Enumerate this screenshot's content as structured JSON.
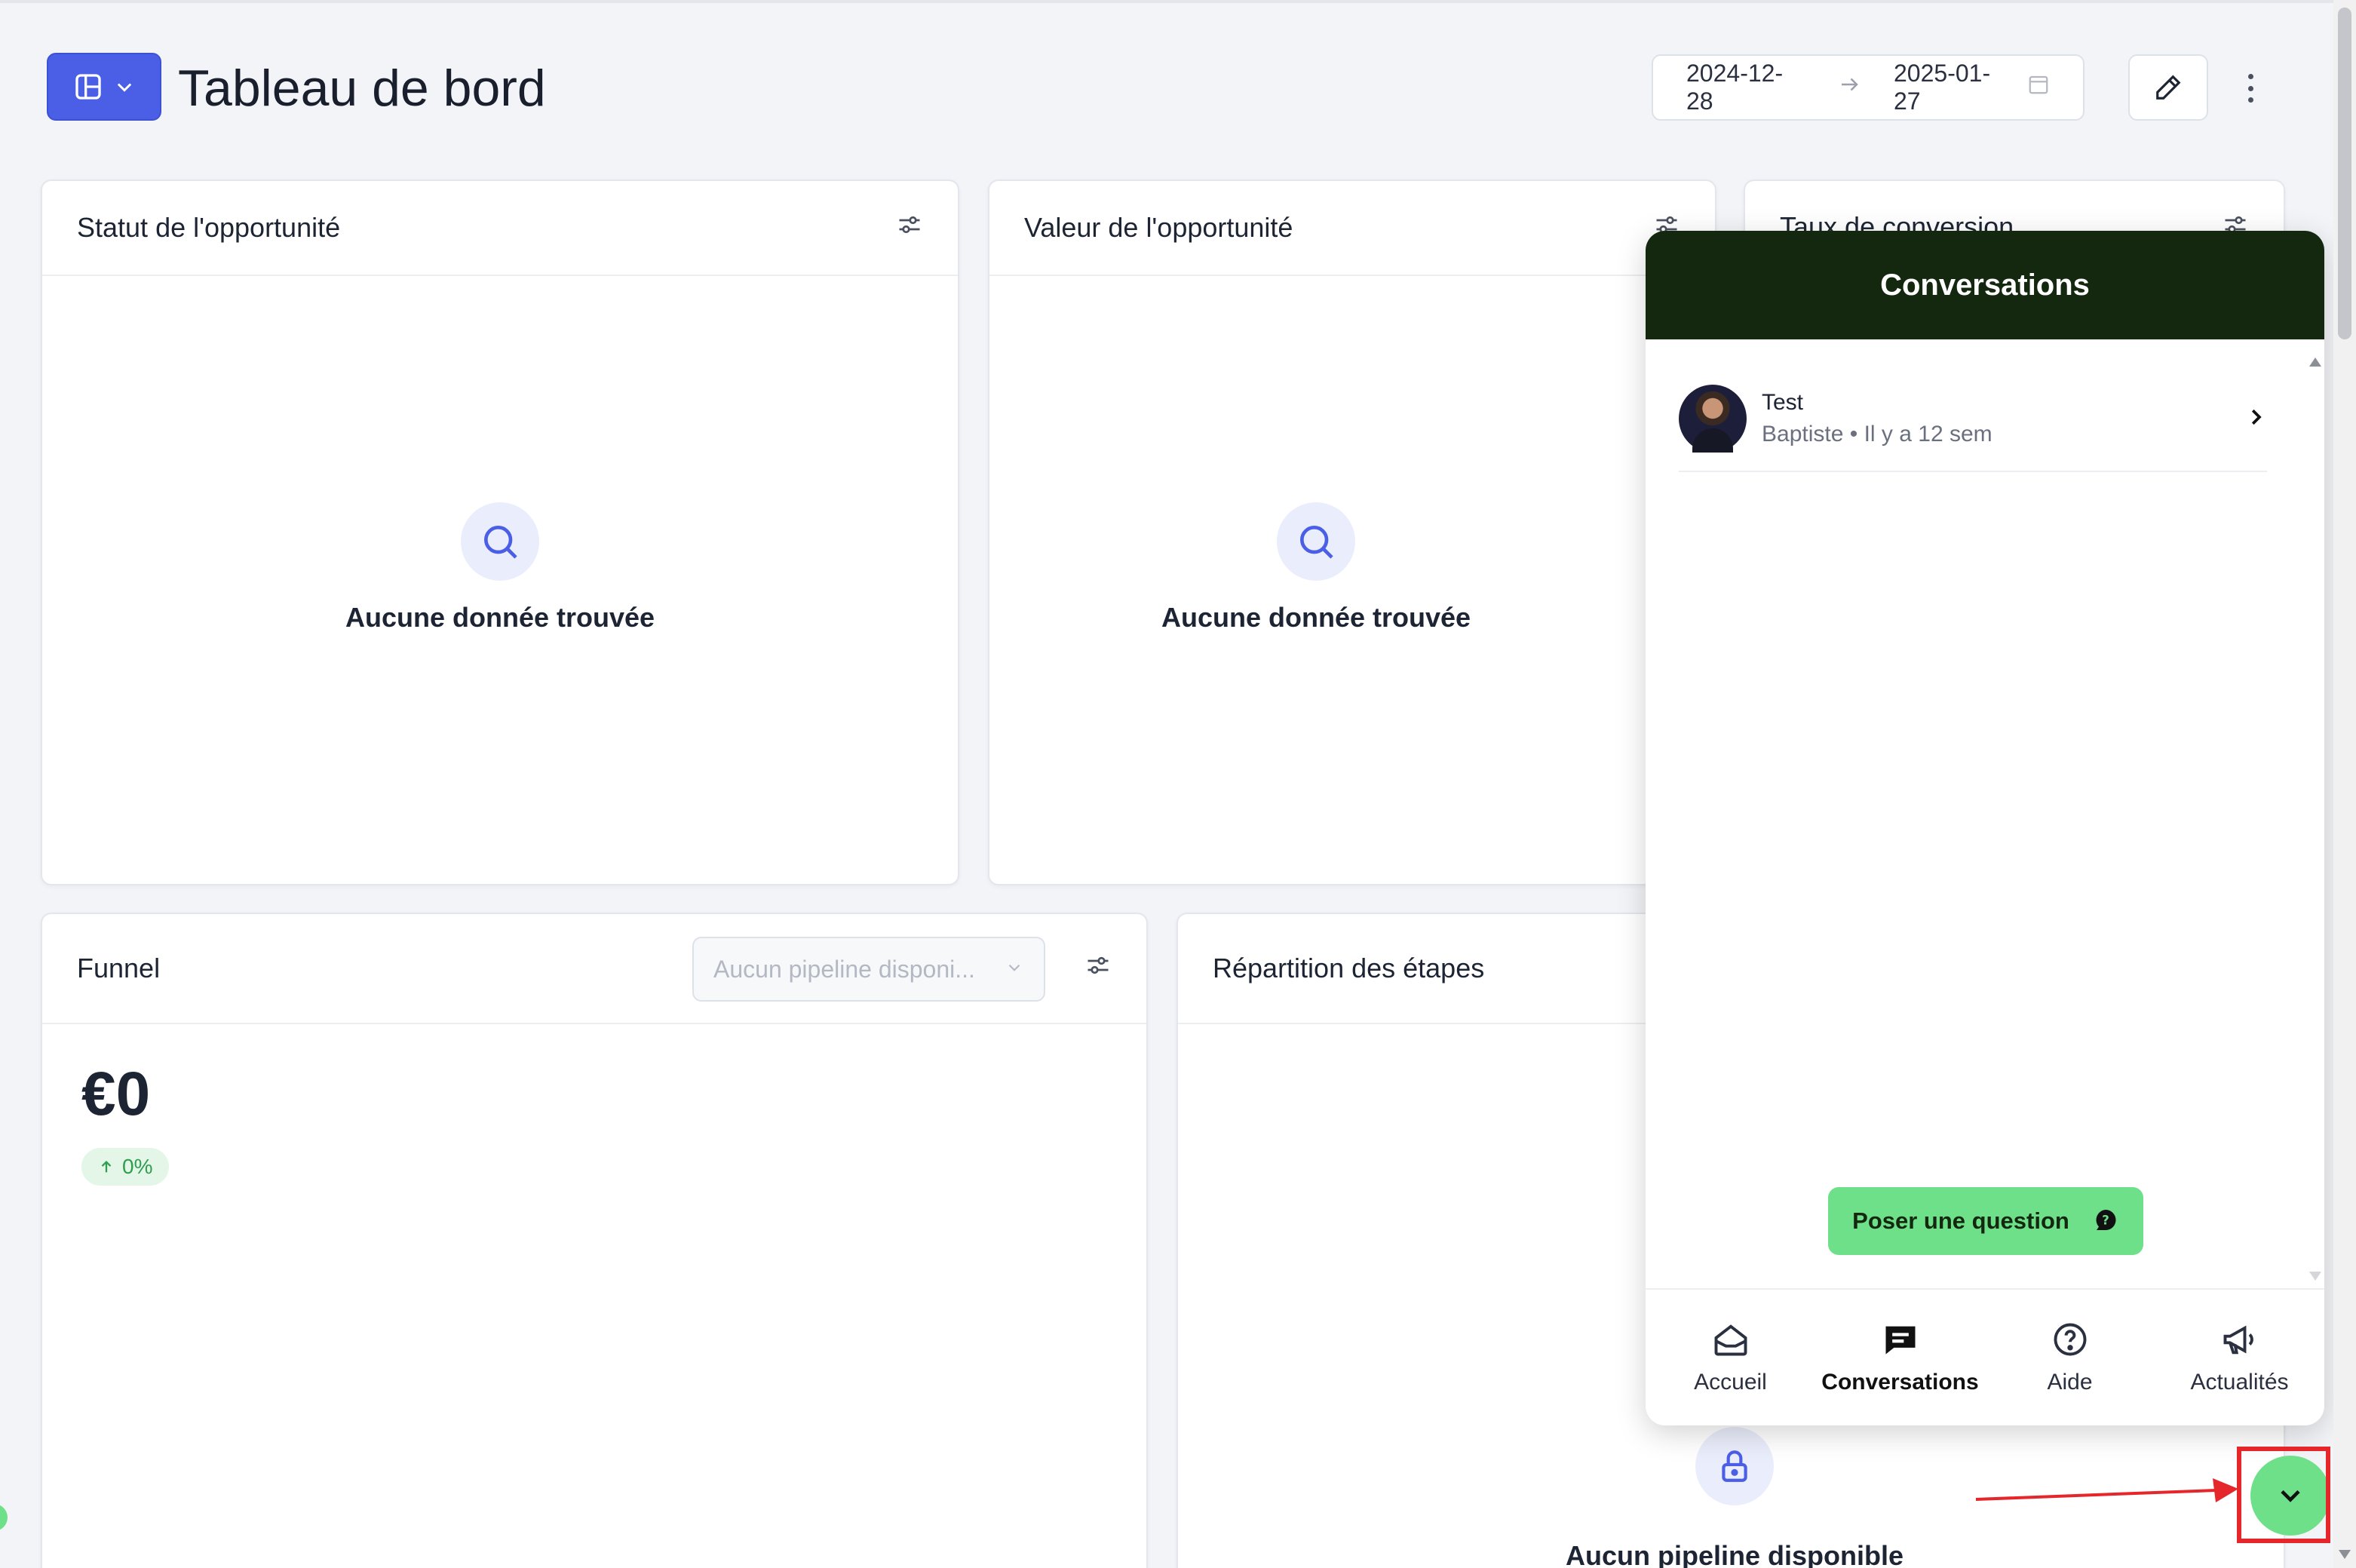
{
  "header": {
    "title": "Tableau de bord",
    "date_start": "2024-12-28",
    "date_end": "2025-01-27"
  },
  "cards": {
    "status": {
      "title": "Statut de l'opportunité",
      "empty_text": "Aucune donnée trouvée"
    },
    "value": {
      "title": "Valeur de l'opportunité",
      "empty_text": "Aucune donnée trouvée"
    },
    "conversion": {
      "title": "Taux de conversion"
    },
    "funnel": {
      "title": "Funnel",
      "pipeline_placeholder": "Aucun pipeline disponi...",
      "amount": "€0",
      "delta": "0%"
    },
    "stages": {
      "title": "Répartition des étapes",
      "empty_text": "Aucun pipeline disponible"
    }
  },
  "chat": {
    "title": "Conversations",
    "conversations": [
      {
        "title": "Test",
        "subtitle": "Baptiste • Il y a 12 sem"
      }
    ],
    "ask_button": "Poser une question",
    "nav": [
      {
        "label": "Accueil",
        "icon": "home-icon",
        "active": false
      },
      {
        "label": "Conversations",
        "icon": "chat-icon",
        "active": true
      },
      {
        "label": "Aide",
        "icon": "help-icon",
        "active": false
      },
      {
        "label": "Actualités",
        "icon": "megaphone-icon",
        "active": false
      }
    ]
  },
  "colors": {
    "primary": "#4a5fe6",
    "chat_header": "#13280e",
    "chat_accent": "#6fe08a",
    "highlight": "#e5262b"
  }
}
